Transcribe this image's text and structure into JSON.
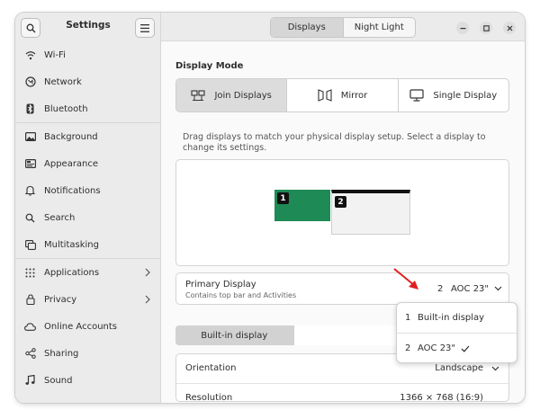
{
  "sidebar": {
    "title": "Settings",
    "items": [
      {
        "label": "Wi-Fi",
        "icon": "wifi-icon"
      },
      {
        "label": "Network",
        "icon": "network-icon"
      },
      {
        "label": "Bluetooth",
        "icon": "bluetooth-icon"
      },
      {
        "label": "Background",
        "icon": "background-icon"
      },
      {
        "label": "Appearance",
        "icon": "appearance-icon"
      },
      {
        "label": "Notifications",
        "icon": "bell-icon"
      },
      {
        "label": "Search",
        "icon": "search-icon"
      },
      {
        "label": "Multitasking",
        "icon": "multitasking-icon"
      },
      {
        "label": "Applications",
        "icon": "grid-icon"
      },
      {
        "label": "Privacy",
        "icon": "lock-icon"
      },
      {
        "label": "Online Accounts",
        "icon": "cloud-icon"
      },
      {
        "label": "Sharing",
        "icon": "share-icon"
      },
      {
        "label": "Sound",
        "icon": "music-note-icon"
      }
    ]
  },
  "header": {
    "tabs": [
      {
        "label": "Displays",
        "active": true
      },
      {
        "label": "Night Light",
        "active": false
      }
    ]
  },
  "display_mode": {
    "title": "Display Mode",
    "options": [
      {
        "label": "Join Displays",
        "active": true
      },
      {
        "label": "Mirror",
        "active": false
      },
      {
        "label": "Single Display",
        "active": false
      }
    ]
  },
  "arrangement": {
    "help": "Drag displays to match your physical display setup. Select a display to change its settings.",
    "monitors": [
      {
        "number": "1",
        "color": "#1e8a55"
      },
      {
        "number": "2",
        "color": "#f2f2f2"
      }
    ]
  },
  "primary_display": {
    "title": "Primary Display",
    "subtitle": "Contains top bar and Activities",
    "number": "2",
    "value": "AOC 23\""
  },
  "popover": {
    "items": [
      {
        "number": "1",
        "label": "Built-in display",
        "checked": false
      },
      {
        "number": "2",
        "label": "AOC 23\"",
        "checked": true
      }
    ]
  },
  "display_tabs": [
    {
      "label": "Built-in display",
      "active": true
    },
    {
      "label": "",
      "active": false
    }
  ],
  "settings": {
    "orientation_label": "Orientation",
    "orientation_value": "Landscape",
    "resolution_label": "Resolution",
    "resolution_value": "1366 × 768 (16:9)"
  },
  "colors": {
    "accent_arrow": "#e02020",
    "monitor_active": "#1e8a55"
  }
}
